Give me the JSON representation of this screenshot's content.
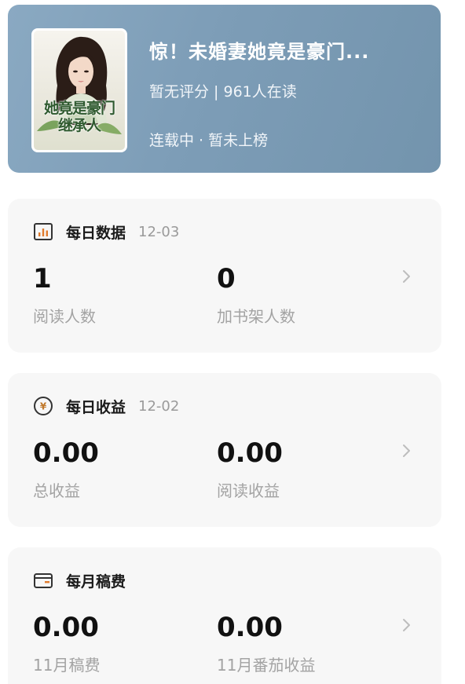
{
  "book": {
    "title": "惊！未婚妻她竟是豪门...",
    "meta": "暂无评分 | 961人在读",
    "status": "连载中 · 暂未上榜",
    "cover_text": "她竟是豪门继承人"
  },
  "daily_data": {
    "title": "每日数据",
    "date": "12-03",
    "icon": "bar-chart-icon",
    "metrics": [
      {
        "value": "1",
        "label": "阅读人数"
      },
      {
        "value": "0",
        "label": "加书架人数"
      }
    ]
  },
  "daily_income": {
    "title": "每日收益",
    "date": "12-02",
    "icon": "yuan-coin-icon",
    "metrics": [
      {
        "value": "0.00",
        "label": "总收益"
      },
      {
        "value": "0.00",
        "label": "阅读收益"
      }
    ]
  },
  "monthly_fee": {
    "title": "每月稿费",
    "icon": "wallet-icon",
    "metrics": [
      {
        "value": "0.00",
        "label": "11月稿费"
      },
      {
        "value": "0.00",
        "label": "11月番茄收益"
      }
    ]
  },
  "colors": {
    "header_bg": "#7d9db7",
    "card_bg": "#f7f7f7",
    "income_icon": "#c0782a"
  }
}
